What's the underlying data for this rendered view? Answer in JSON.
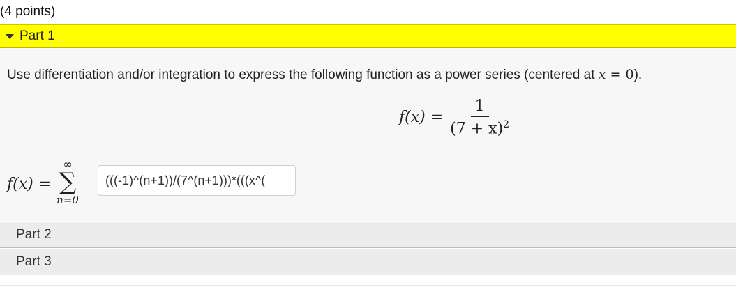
{
  "points": "(4 points)",
  "part1": {
    "label": "Part 1",
    "expanded": true
  },
  "question": {
    "text": "Use differentiation and/or integration to express the following function as a power series (centered at ",
    "math_var": "x",
    "math_rest": " = 0",
    "end": ")."
  },
  "function_display": {
    "lhs": "f(x) =",
    "numerator": "1",
    "denominator_base": "(7 + x)",
    "denominator_exp": "2"
  },
  "summation": {
    "lhs": "f(x) =",
    "upper": "∞",
    "symbol": "∑",
    "lower": "n=0"
  },
  "answer_input": {
    "value": "(((-1)^(n+1))/(7^(n+1)))*(((x^("
  },
  "parts": [
    {
      "label": "Part 2"
    },
    {
      "label": "Part 3"
    }
  ],
  "colors": {
    "active_header": "#ffff00",
    "collapsed_header": "#ececec"
  }
}
